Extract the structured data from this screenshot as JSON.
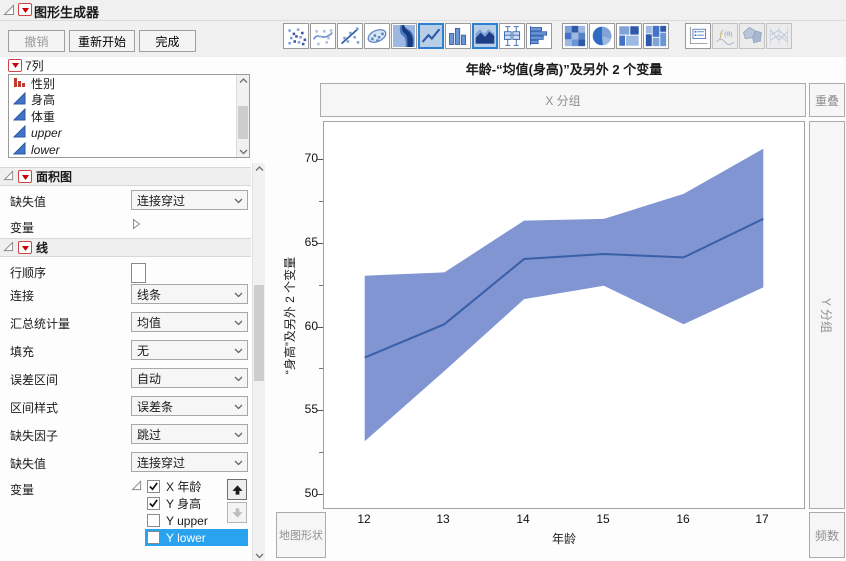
{
  "window": {
    "title": "图形生成器"
  },
  "action_buttons": {
    "undo": "撤销",
    "restart": "重新开始",
    "done": "完成"
  },
  "chart_type_icons": [
    {
      "name": "points-icon"
    },
    {
      "name": "smoother-icon"
    },
    {
      "name": "line-of-fit-icon"
    },
    {
      "name": "ellipse-icon"
    },
    {
      "name": "contour-icon"
    },
    {
      "name": "line-chart-icon",
      "selected": true
    },
    {
      "name": "bar-chart-icon"
    },
    {
      "name": "area-chart-icon",
      "selected": true
    },
    {
      "name": "box-plot-icon"
    },
    {
      "name": "histogram-icon"
    },
    {
      "name": "heatmap-icon"
    },
    {
      "name": "pie-chart-icon"
    },
    {
      "name": "treemap-icon"
    },
    {
      "name": "mosaic-icon"
    },
    {
      "name": "caption-box-icon"
    },
    {
      "name": "formula-icon",
      "disabled": true
    },
    {
      "name": "map-shapes-icon",
      "disabled": true
    },
    {
      "name": "parallel-plot-icon",
      "disabled": true
    }
  ],
  "columns_panel": {
    "header": "7列",
    "items": [
      {
        "label": "性别",
        "type": "nominal",
        "italic": false
      },
      {
        "label": "身高",
        "type": "continuous",
        "italic": false
      },
      {
        "label": "体重",
        "type": "continuous",
        "italic": false
      },
      {
        "label": "upper",
        "type": "continuous",
        "italic": true
      },
      {
        "label": "lower",
        "type": "continuous",
        "italic": true
      }
    ]
  },
  "properties": {
    "rows": [
      {
        "type": "section",
        "title": "面积图"
      },
      {
        "type": "dropdown",
        "label": "缺失值",
        "value": "连接穿过"
      },
      {
        "type": "collapsed",
        "label": "变量"
      },
      {
        "type": "section",
        "title": "线"
      },
      {
        "type": "checkbox",
        "label": "行顺序",
        "checked": false
      },
      {
        "type": "dropdown",
        "label": "连接",
        "value": "线条"
      },
      {
        "type": "dropdown",
        "label": "汇总统计量",
        "value": "均值"
      },
      {
        "type": "dropdown",
        "label": "填充",
        "value": "无"
      },
      {
        "type": "dropdown",
        "label": "误差区间",
        "value": "自动"
      },
      {
        "type": "dropdown",
        "label": "区间样式",
        "value": "误差条"
      },
      {
        "type": "dropdown",
        "label": "缺失因子",
        "value": "跳过"
      },
      {
        "type": "dropdown",
        "label": "缺失值",
        "value": "连接穿过"
      },
      {
        "type": "expanded",
        "label": "变量"
      }
    ],
    "variables": [
      {
        "role": "X",
        "name": "年龄",
        "checked": true,
        "selected": false
      },
      {
        "role": "Y",
        "name": "身高",
        "checked": true,
        "selected": false
      },
      {
        "role": "Y",
        "name": "upper",
        "checked": false,
        "selected": false
      },
      {
        "role": "Y",
        "name": "lower",
        "checked": false,
        "selected": true
      }
    ]
  },
  "graph": {
    "title": "年龄-“均值(身高)”及另外 2 个变量",
    "drop_zones": {
      "x_group": "X 分组",
      "overlay": "重叠",
      "y_group": "Y 分组",
      "map_shape": "地图形状",
      "frequency": "频数"
    }
  },
  "chart_data": {
    "type": "line",
    "x": [
      12,
      13,
      14,
      15,
      16,
      17
    ],
    "series": [
      {
        "name": "均值(身高)",
        "style": "line",
        "values": [
          58.2,
          60.2,
          64.1,
          64.4,
          64.2,
          66.5
        ]
      },
      {
        "name": "upper",
        "style": "band-upper",
        "values": [
          63.1,
          63.3,
          66.4,
          66.5,
          68.0,
          70.7
        ]
      },
      {
        "name": "lower",
        "style": "band-lower",
        "values": [
          53.2,
          57.4,
          61.7,
          62.5,
          60.2,
          62.4
        ]
      }
    ],
    "title": "年龄-“均值(身高)”及另外 2 个变量",
    "xlabel": "年龄",
    "ylabel": "“身高”及另外 2 个变量",
    "xlim": [
      11.49,
      17.51
    ],
    "ylim": [
      49.2,
      72.3
    ],
    "xticks": [
      12,
      13,
      14,
      15,
      16,
      17
    ],
    "yticks": [
      50,
      55,
      60,
      65,
      70
    ],
    "y_minor_ticks": [
      52.5,
      57.5,
      62.5,
      67.5
    ],
    "grid": false,
    "legend": "none",
    "band_color": "#8095d1",
    "line_color": "#3a5fa8"
  },
  "colors": {
    "selection_blue": "#29a3ef",
    "icon_selected_bg": "#b9cfe8",
    "icon_selected_border": "#2f7fd0",
    "band_fill": "#8095d1",
    "mean_line": "#3a5fa8"
  }
}
